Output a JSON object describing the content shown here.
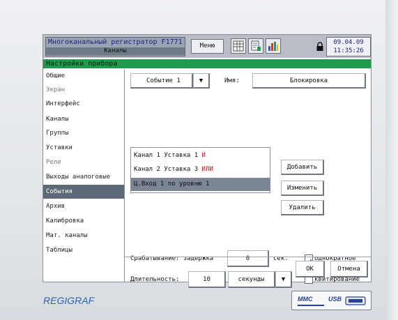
{
  "header": {
    "title": "Многоканальный регистратор F1771",
    "subtitle": "Каналы",
    "menu_label": "Меню",
    "date": "09.04.09",
    "time": "11:35:26"
  },
  "section_title": "Настройки прибора",
  "sidebar": {
    "items": [
      {
        "label": "Общие"
      },
      {
        "label": "Экран"
      },
      {
        "label": "Интерфейс"
      },
      {
        "label": "Каналы"
      },
      {
        "label": "Группы"
      },
      {
        "label": "Уставки"
      },
      {
        "label": "Реле"
      },
      {
        "label": "Выходы аналоговые"
      },
      {
        "label": "События"
      },
      {
        "label": "Архив"
      },
      {
        "label": "Калибровка"
      },
      {
        "label": "Мат. каналы"
      },
      {
        "label": "Таблицы"
      }
    ],
    "active_index": 8
  },
  "event": {
    "selector_value": "Событие 1",
    "name_label": "Имя:",
    "name_value": "Блокировка"
  },
  "conditions": [
    {
      "text": "Канал 1 Уставка 1",
      "op": "И"
    },
    {
      "text": "Канал 2 Уставка 3",
      "op": "ИЛИ"
    },
    {
      "text": "Ц.Вход 1 по уровню 1",
      "op": ""
    }
  ],
  "actions": {
    "add": "Добавить",
    "edit": "Изменить",
    "delete": "Удалить"
  },
  "trigger": {
    "label": "Срабатывание: задержка",
    "value": "0",
    "unit": "сек.",
    "once_label": "однократное",
    "once_checked": true
  },
  "duration": {
    "label": "Длительность:",
    "value": "10",
    "unit_value": "секунды",
    "ack_label": "квитирование",
    "ack_checked": false
  },
  "footer": {
    "ok": "ОК",
    "cancel": "Отмена"
  },
  "device": {
    "brand": "REGIGRAF",
    "port_mmc": "MMC",
    "port_usb": "USB"
  },
  "colors": {
    "section_green": "#1f9a4a",
    "selection_gray": "#5e6978",
    "operator_red": "#cc1020",
    "brand_blue": "#2a63b6"
  }
}
